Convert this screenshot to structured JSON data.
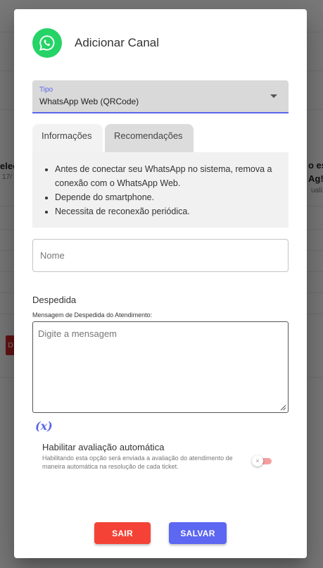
{
  "background": {
    "left_text_1": "elec",
    "left_text_2": "17/",
    "right_text_1": "o es",
    "right_text_2": "Ag!",
    "right_text_3": "ualiz",
    "left_button": "D"
  },
  "dialog": {
    "title": "Adicionar Canal",
    "icon": "whatsapp-icon",
    "type_select": {
      "label": "Tipo",
      "value": "WhatsApp Web (QRCode)"
    },
    "tabs": [
      {
        "label": "Informações",
        "active": true
      },
      {
        "label": "Recomendações",
        "active": false
      }
    ],
    "info_items": [
      "Antes de conectar seu WhatsApp no sistema, remova a conexão com o WhatsApp Web.",
      "Depende do smartphone.",
      "Necessita de reconexão periódica."
    ],
    "name_field": {
      "placeholder": "Nome",
      "value": ""
    },
    "farewell": {
      "title": "Despedida",
      "subtitle": "Mensagem de Despedida do Atendimento:",
      "placeholder": "Digite a mensagem",
      "variables_button": "(x)"
    },
    "auto_rating": {
      "title": "Habilitar avaliação automática",
      "description": "Habilitando esta opção será enviada a avaliação do atendimento de maneira automática na resolução de cada ticket.",
      "enabled": false,
      "thumb_icon": "×"
    },
    "buttons": {
      "cancel": "SAIR",
      "save": "SALVAR"
    }
  },
  "colors": {
    "primary": "#5c67f2",
    "danger": "#f44336",
    "whatsapp": "#25d366"
  }
}
